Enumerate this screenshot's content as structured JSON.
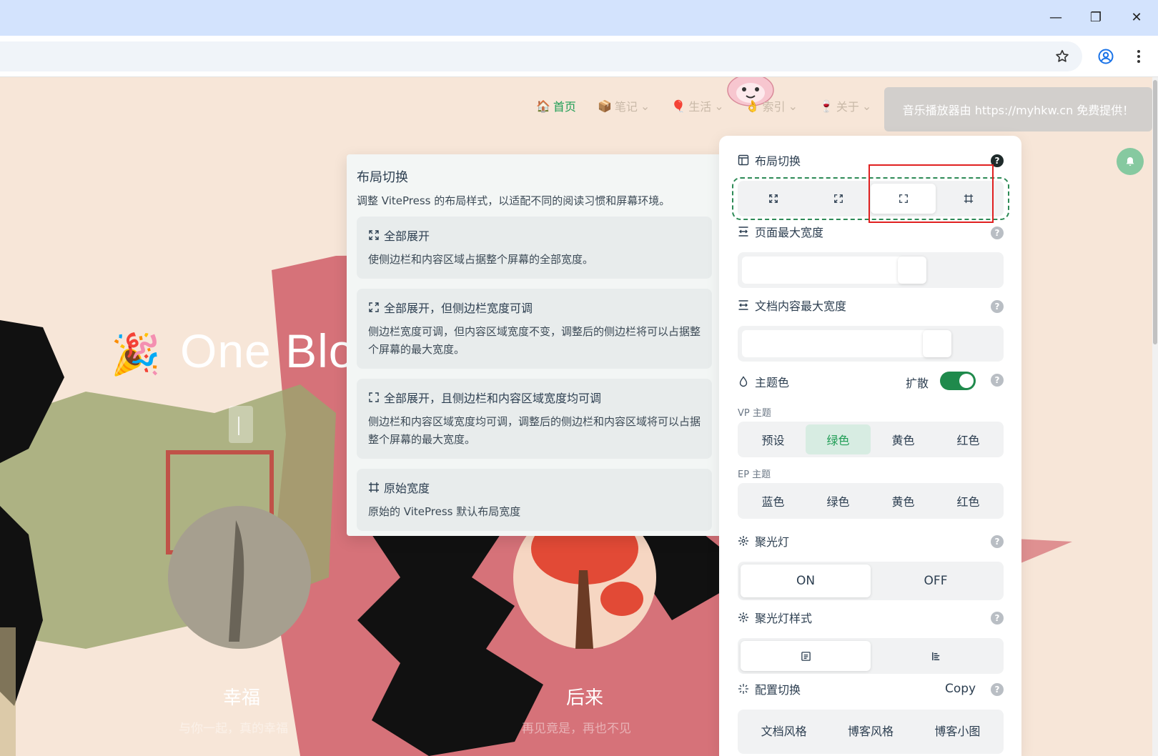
{
  "browser": {
    "window_controls": {
      "minimize": "—",
      "restore": "❐",
      "close": "✕"
    }
  },
  "nav": {
    "items": [
      {
        "label": "首页",
        "icon": "home-icon",
        "emoji": "🏠"
      },
      {
        "label": "笔记",
        "icon": "notebook-icon",
        "emoji": "📦"
      },
      {
        "label": "生活",
        "icon": "balloon-icon",
        "emoji": "🎈"
      },
      {
        "label": "索引",
        "icon": "hand-icon",
        "emoji": "👌"
      },
      {
        "label": "关于",
        "icon": "wine-icon",
        "emoji": "🍷"
      }
    ]
  },
  "toast": {
    "text": "音乐播放器由 https://myhkw.cn 免费提供！"
  },
  "hero": {
    "title": "One Blo",
    "cards": [
      {
        "title": "幸福",
        "subtitle": "与你一起，真的幸福"
      },
      {
        "title": "后来",
        "subtitle": "再见竟是，再也不见"
      }
    ]
  },
  "tooltip": {
    "title": "布局切换",
    "description": "调整 VitePress 的布局样式，以适配不同的阅读习惯和屏幕环境。",
    "options": [
      {
        "title": "全部展开",
        "desc": "使侧边栏和内容区域占据整个屏幕的全部宽度。"
      },
      {
        "title": "全部展开，但侧边栏宽度可调",
        "desc": "侧边栏宽度可调，但内容区域宽度不变，调整后的侧边栏将可以占据整个屏幕的最大宽度。"
      },
      {
        "title": "全部展开，且侧边栏和内容区域宽度均可调",
        "desc": "侧边栏和内容区域宽度均可调，调整后的侧边栏和内容区域将可以占据整个屏幕的最大宽度。"
      },
      {
        "title": "原始宽度",
        "desc": "原始的 VitePress 默认布局宽度"
      }
    ]
  },
  "panel": {
    "layout": {
      "label": "布局切换",
      "selected_index": 2
    },
    "page_max_width": {
      "label": "页面最大宽度",
      "value_fraction": 0.68
    },
    "doc_max_width": {
      "label": "文档内容最大宽度",
      "value_fraction": 0.79
    },
    "theme": {
      "label": "主题色",
      "spread_label": "扩散",
      "spread_on": true,
      "vp_label": "VP 主题",
      "vp_options": [
        "预设",
        "绿色",
        "黄色",
        "红色"
      ],
      "vp_selected": 1,
      "ep_label": "EP 主题",
      "ep_options": [
        "蓝色",
        "绿色",
        "黄色",
        "红色"
      ]
    },
    "spotlight": {
      "label": "聚光灯",
      "options": [
        "ON",
        "OFF"
      ],
      "selected": 0
    },
    "spotlight_style": {
      "label": "聚光灯样式"
    },
    "config": {
      "label": "配置切换",
      "copy_label": "Copy",
      "options": [
        "文档风格",
        "博客风格",
        "博客小图"
      ]
    },
    "accent": "#1f8a4c"
  }
}
